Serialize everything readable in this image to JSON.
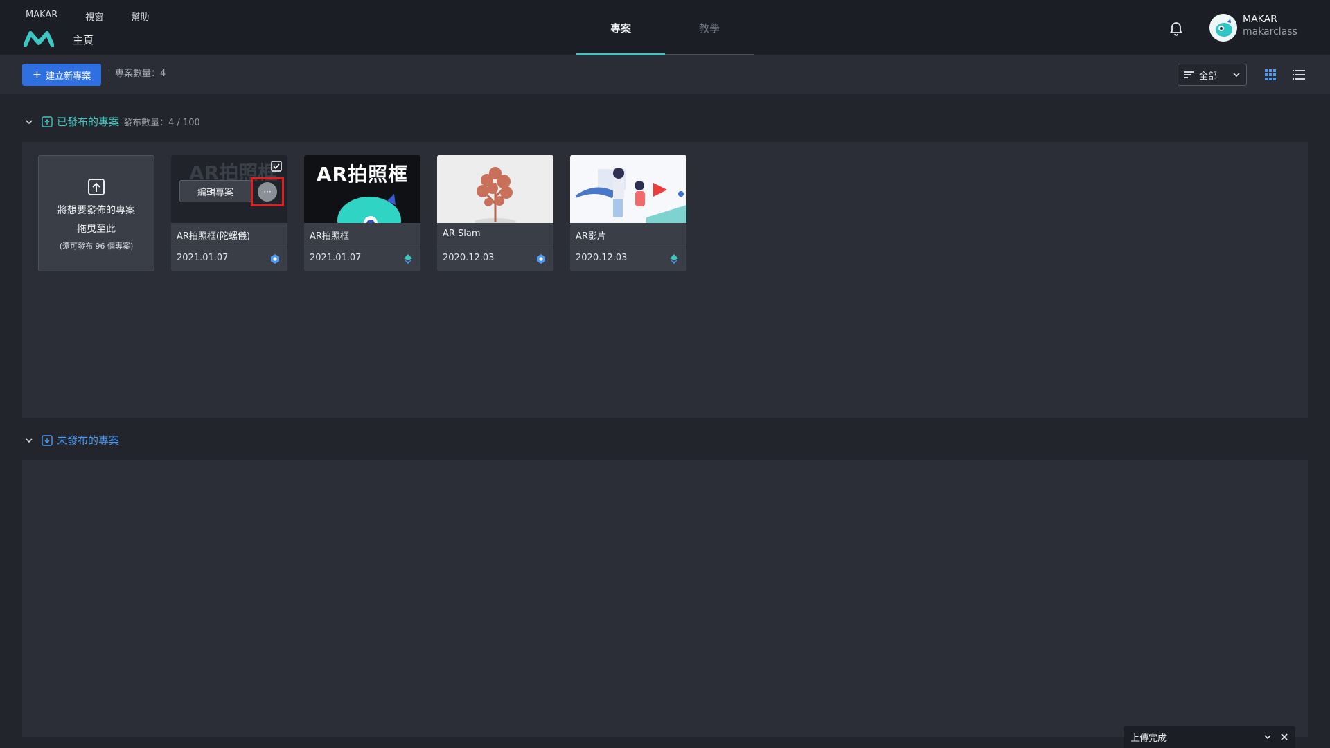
{
  "menubar": {
    "app": "MAKAR",
    "view": "視窗",
    "help": "幫助"
  },
  "header": {
    "home_label": "主頁",
    "tabs": [
      {
        "label": "專案"
      },
      {
        "label": "教學"
      }
    ],
    "user": {
      "name": "MAKAR",
      "id": "makarclass"
    }
  },
  "toolbar": {
    "new_project_label": "建立新專案",
    "project_count_label": "專案數量：4",
    "filter_value": "全部"
  },
  "published": {
    "title": "已發布的專案",
    "count_label": "發布數量：4 / 100",
    "dropzone": {
      "line1": "將想要發佈的專案",
      "line2": "拖曳至此",
      "line3": "(還可發布 96 個專案)"
    },
    "edit_label": "編輯專案",
    "more_label": "···",
    "projects": [
      {
        "name": "AR拍照框(陀螺儀)",
        "date": "2021.01.07",
        "platform": "hex-badge-icon",
        "thumb_text": "AR拍照框"
      },
      {
        "name": "AR拍照框",
        "date": "2021.01.07",
        "platform": "pin-badge-icon",
        "thumb_text": "AR拍照框"
      },
      {
        "name": "AR Slam",
        "date": "2020.12.03",
        "platform": "hex-badge-icon"
      },
      {
        "name": "AR影片",
        "date": "2020.12.03",
        "platform": "pin-badge-icon"
      }
    ]
  },
  "unpublished": {
    "title": "未發布的專案"
  },
  "toast": {
    "text": "上傳完成"
  },
  "colors": {
    "accent": "#3ec7c0",
    "primary_button": "#2f6fe0",
    "unpublished_title": "#4e9af1",
    "highlight": "#e02020",
    "background": "#22252c"
  }
}
